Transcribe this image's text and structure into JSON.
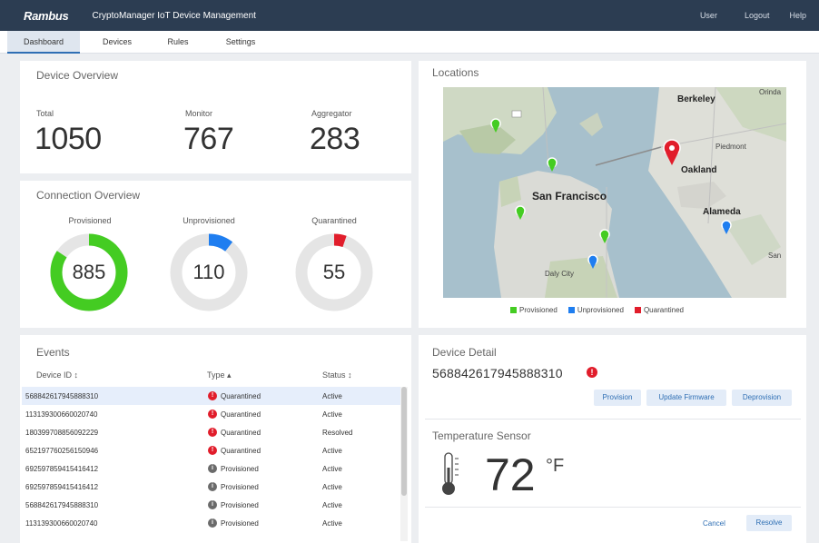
{
  "header": {
    "brand": "Rambus",
    "app_title": "CryptoManager IoT Device Management",
    "links": [
      "User",
      "Logout",
      "Help"
    ]
  },
  "tabs": [
    "Dashboard",
    "Devices",
    "Rules",
    "Settings"
  ],
  "device_overview": {
    "title": "Device Overview",
    "stats": [
      {
        "label": "Total",
        "value": "1050"
      },
      {
        "label": "Monitor",
        "value": "767"
      },
      {
        "label": "Aggregator",
        "value": "283"
      }
    ]
  },
  "connection_overview": {
    "title": "Connection Overview",
    "donuts": [
      {
        "label": "Provisioned",
        "value": "885",
        "fraction": 0.843,
        "color": "#44cc22"
      },
      {
        "label": "Unprovisioned",
        "value": "110",
        "fraction": 0.105,
        "color": "#1f7ef0"
      },
      {
        "label": "Quarantined",
        "value": "55",
        "fraction": 0.052,
        "color": "#e11d2b"
      }
    ]
  },
  "locations": {
    "title": "Locations",
    "places": [
      "Berkeley",
      "Orinda",
      "Oakland",
      "Piedmont",
      "San Francisco",
      "Alameda",
      "Daly City",
      "San"
    ],
    "legend": [
      {
        "label": "Provisioned",
        "color": "#44cc22"
      },
      {
        "label": "Unprovisioned",
        "color": "#1f7ef0"
      },
      {
        "label": "Quarantined",
        "color": "#e11d2b"
      }
    ]
  },
  "events": {
    "title": "Events",
    "columns": [
      "Device ID ↕",
      "Type ▴",
      "Status ↕"
    ],
    "rows": [
      {
        "id": "568842617945888310",
        "type": "Quarantined",
        "status": "Active",
        "icon": "!",
        "icon_color": "#e11d2b"
      },
      {
        "id": "113139300660020740",
        "type": "Quarantined",
        "status": "Active",
        "icon": "!",
        "icon_color": "#e11d2b"
      },
      {
        "id": "180399708856092229",
        "type": "Quarantined",
        "status": "Resolved",
        "icon": "!",
        "icon_color": "#e11d2b"
      },
      {
        "id": "652197760256150946",
        "type": "Quarantined",
        "status": "Active",
        "icon": "!",
        "icon_color": "#e11d2b"
      },
      {
        "id": "692597859415416412",
        "type": "Provisioned",
        "status": "Active",
        "icon": "i",
        "icon_color": "#6b6b6b"
      },
      {
        "id": "692597859415416412",
        "type": "Provisioned",
        "status": "Active",
        "icon": "i",
        "icon_color": "#6b6b6b"
      },
      {
        "id": "568842617945888310",
        "type": "Provisioned",
        "status": "Active",
        "icon": "i",
        "icon_color": "#6b6b6b"
      },
      {
        "id": "113139300660020740",
        "type": "Provisioned",
        "status": "Active",
        "icon": "i",
        "icon_color": "#6b6b6b"
      }
    ]
  },
  "device_detail": {
    "title": "Device Detail",
    "device_id": "568842617945888310",
    "alert_icon": "!",
    "buttons": [
      "Provision",
      "Update Firmware",
      "Deprovision"
    ]
  },
  "temperature": {
    "title": "Temperature Sensor",
    "value": "72",
    "unit": "°F",
    "cancel": "Cancel",
    "resolve": "Resolve"
  }
}
